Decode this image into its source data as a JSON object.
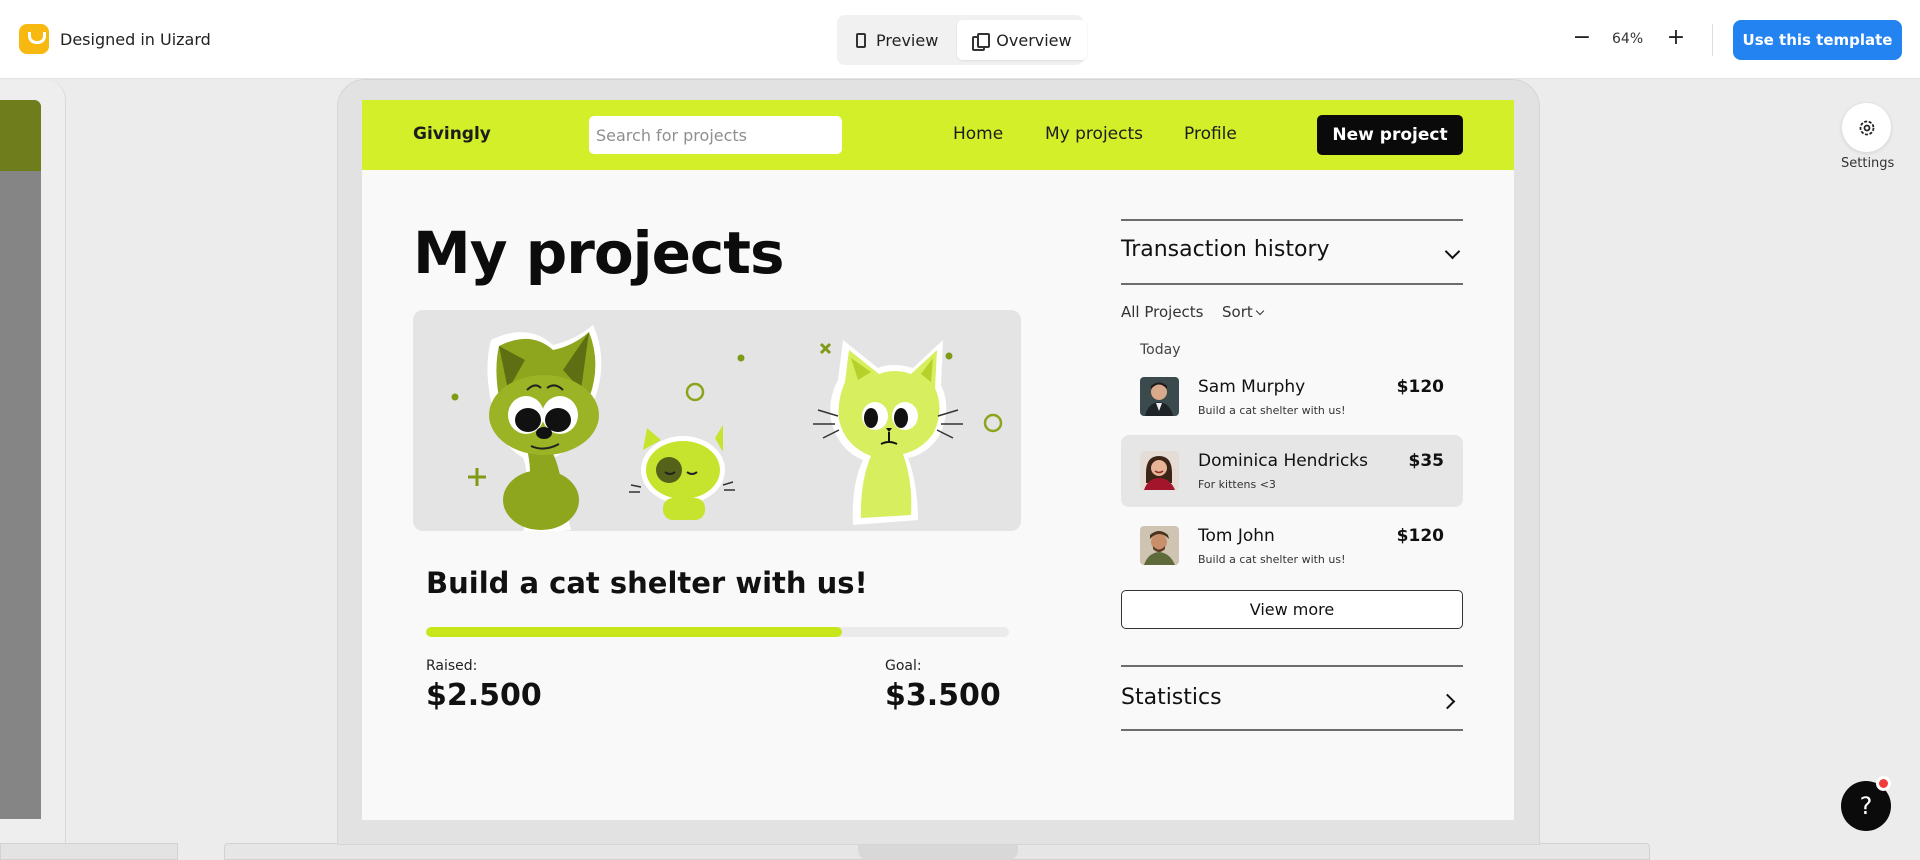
{
  "toolbar": {
    "brand": "Designed in Uizard",
    "modes": [
      {
        "label": "Preview",
        "icon": "phone-icon",
        "active": false
      },
      {
        "label": "Overview",
        "icon": "pages-icon",
        "active": true
      }
    ],
    "zoom": "64%",
    "zoom_out_icon": "minus-icon",
    "zoom_in_icon": "plus-icon",
    "cta_label": "Use this template",
    "cta_color": "#2384f1"
  },
  "side": {
    "settings_label": "Settings",
    "help_label": "?"
  },
  "app": {
    "accent": "#d3ef2a",
    "nav": {
      "logo": "Givingly",
      "search_placeholder": "Search for projects",
      "links": [
        "Home",
        "My projects",
        "Profile"
      ],
      "new_project": "New project"
    },
    "page_title": "My projects",
    "project": {
      "title": "Build a cat shelter with us!",
      "progress_fraction": 0.714,
      "raised_label": "Raised:",
      "raised_value": "$2.500",
      "goal_label": "Goal:",
      "goal_value": "$3.500"
    },
    "transactions": {
      "title": "Transaction history",
      "filter_all": "All Projects",
      "filter_sort": "Sort",
      "day": "Today",
      "items": [
        {
          "name": "Sam Murphy",
          "note": "Build a cat shelter with us!",
          "amount": "$120"
        },
        {
          "name": "Dominica Hendricks",
          "note": "For kittens <3",
          "amount": "$35"
        },
        {
          "name": "Tom John",
          "note": "Build a cat shelter with us!",
          "amount": "$120"
        }
      ],
      "view_more": "View more"
    },
    "statistics": {
      "title": "Statistics"
    }
  }
}
